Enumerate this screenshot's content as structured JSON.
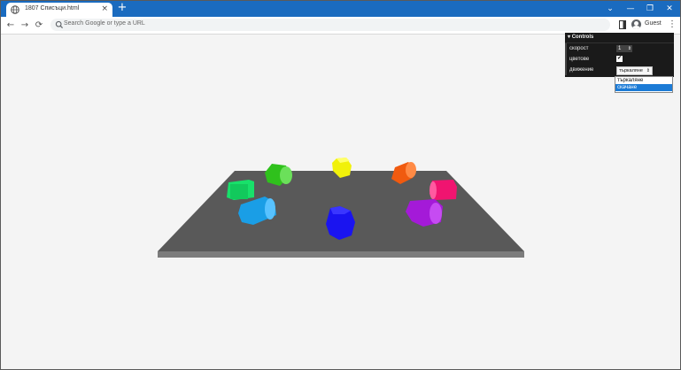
{
  "browser": {
    "tab_title": "1807 Списъци.html",
    "new_tab": "+",
    "close_tab": "×",
    "address_placeholder": "Search Google or type a URL",
    "profile_label": "Guest",
    "window_controls": {
      "chevron": "⌄",
      "minimize": "—",
      "restore": "❐",
      "close": "✕"
    },
    "nav": {
      "back": "←",
      "forward": "→",
      "reload": "⟳",
      "menu": "⋮"
    }
  },
  "controls": {
    "header": "Controls",
    "speed_label": "скорост",
    "speed_value": "1",
    "colors_label": "цветове",
    "colors_checked": "✔",
    "motion_label": "движение",
    "motion_value": "търкаляне",
    "motion_options": [
      "търкаляне",
      "скачане"
    ],
    "motion_highlighted": "скачане"
  },
  "scene": {
    "platform_color": "#595959",
    "background": "#f4f4f4",
    "objects": [
      {
        "name": "green-cylinder",
        "color": "#2fc11c"
      },
      {
        "name": "yellow-cylinder",
        "color": "#f1f10a"
      },
      {
        "name": "orange-cylinder",
        "color": "#f05a0f"
      },
      {
        "name": "spring-green-cylinder",
        "color": "#18e06a"
      },
      {
        "name": "pink-cylinder",
        "color": "#f01470"
      },
      {
        "name": "sky-blue-cylinder",
        "color": "#1a9ee6"
      },
      {
        "name": "blue-cylinder",
        "color": "#1a14f0"
      },
      {
        "name": "purple-cylinder",
        "color": "#a41ad8"
      }
    ]
  }
}
